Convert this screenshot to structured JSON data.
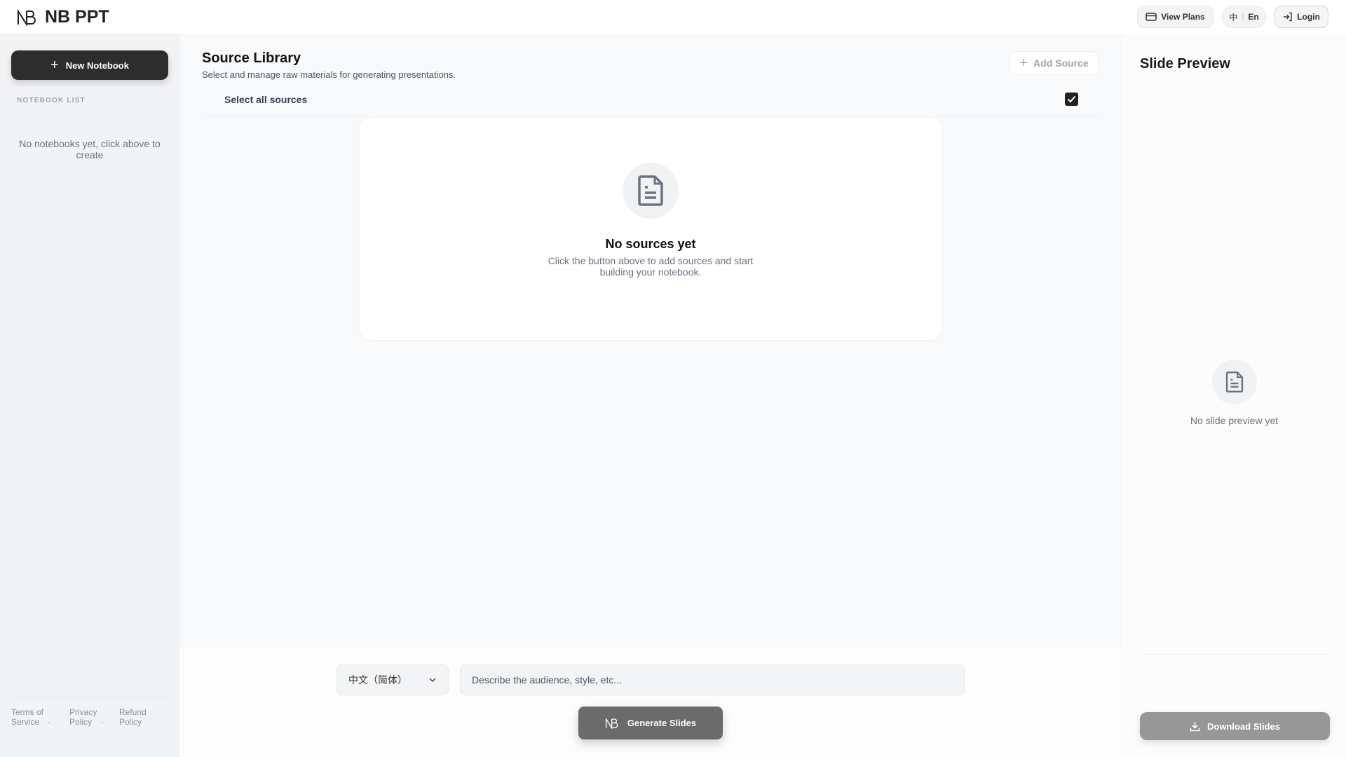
{
  "header": {
    "app_name": "NB PPT",
    "view_plans": "View Plans",
    "lang_zh": "中",
    "lang_en": "En",
    "login": "Login"
  },
  "sidebar": {
    "new_notebook": "New Notebook",
    "section_label": "NOTEBOOK LIST",
    "empty_text": "No notebooks yet, click above to create",
    "footer_links": [
      {
        "l1": "Terms of",
        "l2": "Service"
      },
      {
        "l1": "Privacy",
        "l2": "Policy"
      },
      {
        "l1": "Refund",
        "l2": "Policy"
      }
    ],
    "separator": "·"
  },
  "main": {
    "title": "Source Library",
    "subtitle": "Select and manage raw materials for generating presentations.",
    "add_source": "Add Source",
    "select_all": "Select all sources",
    "select_all_checked": true,
    "empty_title": "No sources yet",
    "empty_desc": "Click the button above to add sources and start building your notebook."
  },
  "composer": {
    "language": "中文（简体）",
    "prompt_placeholder": "Describe the audience, style, etc...",
    "generate": "Generate Slides"
  },
  "preview": {
    "title": "Slide Preview",
    "empty_text": "No slide preview yet",
    "download": "Download Slides"
  }
}
